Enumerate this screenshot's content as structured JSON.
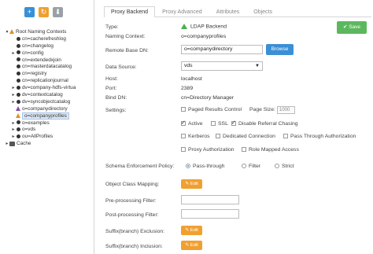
{
  "toolbar": {
    "add": "+",
    "refresh": "↻",
    "download": "⬇"
  },
  "tree": {
    "root_label": "Root Naming Contexts",
    "items": [
      {
        "label": "cn=cacherefreshlog"
      },
      {
        "label": "cn=changelog"
      },
      {
        "label": "cn=config"
      },
      {
        "label": "cn=extendedxjoin"
      },
      {
        "label": "cn=masterdatacatalog"
      },
      {
        "label": "cn=registry"
      },
      {
        "label": "cn=replicationjournal"
      },
      {
        "label": "dv=company-hdfs-virtua"
      },
      {
        "label": "dv=contextcatalog"
      },
      {
        "label": "dv=syncobjectcatalog"
      },
      {
        "label": "o=companydirectory"
      },
      {
        "label": "o=companyprofiles"
      },
      {
        "label": "o=examples"
      },
      {
        "label": "o=vds"
      },
      {
        "label": "ou=AllProfiles"
      }
    ],
    "cache_label": "Cache"
  },
  "tabs": [
    "Proxy Backend",
    "Proxy Advanced",
    "Attributes",
    "Objects"
  ],
  "save_label": "Save",
  "form": {
    "type_label": "Type:",
    "type_value": "LDAP Backend",
    "naming_context_label": "Naming Context:",
    "naming_context_value": "o=companyprofiles",
    "remote_base_dn_label": "Remote Base DN:",
    "remote_base_dn_value": "o=companydirectory",
    "browse_label": "Browse",
    "data_source_label": "Data Source:",
    "data_source_value": "vds",
    "host_label": "Host:",
    "host_value": "localhost",
    "port_label": "Port:",
    "port_value": "2389",
    "bind_dn_label": "Bind DN:",
    "bind_dn_value": "cn=Directory Manager",
    "settings_label": "Settings:",
    "paged_results": "Paged Results Control",
    "page_size_label": "Page Size:",
    "page_size_value": "1000",
    "active": "Active",
    "ssl": "SSL",
    "disable_referral": "Disable Referral Chasing",
    "kerberos": "Kerberos",
    "dedicated_connection": "Dedicated Connection",
    "pass_through_auth": "Pass Through Authorization",
    "proxy_authorization": "Proxy Authorization",
    "role_mapped_access": "Role Mapped Access",
    "schema_label": "Schema Enforcement Policy:",
    "schema_pass": "Pass-through",
    "schema_filter": "Filter",
    "schema_strict": "Strict",
    "object_class_label": "Object Class Mapping:",
    "pre_filter_label": "Pre-processing Filter:",
    "post_filter_label": "Post-processing Filter:",
    "suffix_exclusion_label": "Suffix(branch) Exclusion:",
    "suffix_inclusion_label": "Suffix(branch) Inclusion:",
    "edit_label": "Edit"
  }
}
